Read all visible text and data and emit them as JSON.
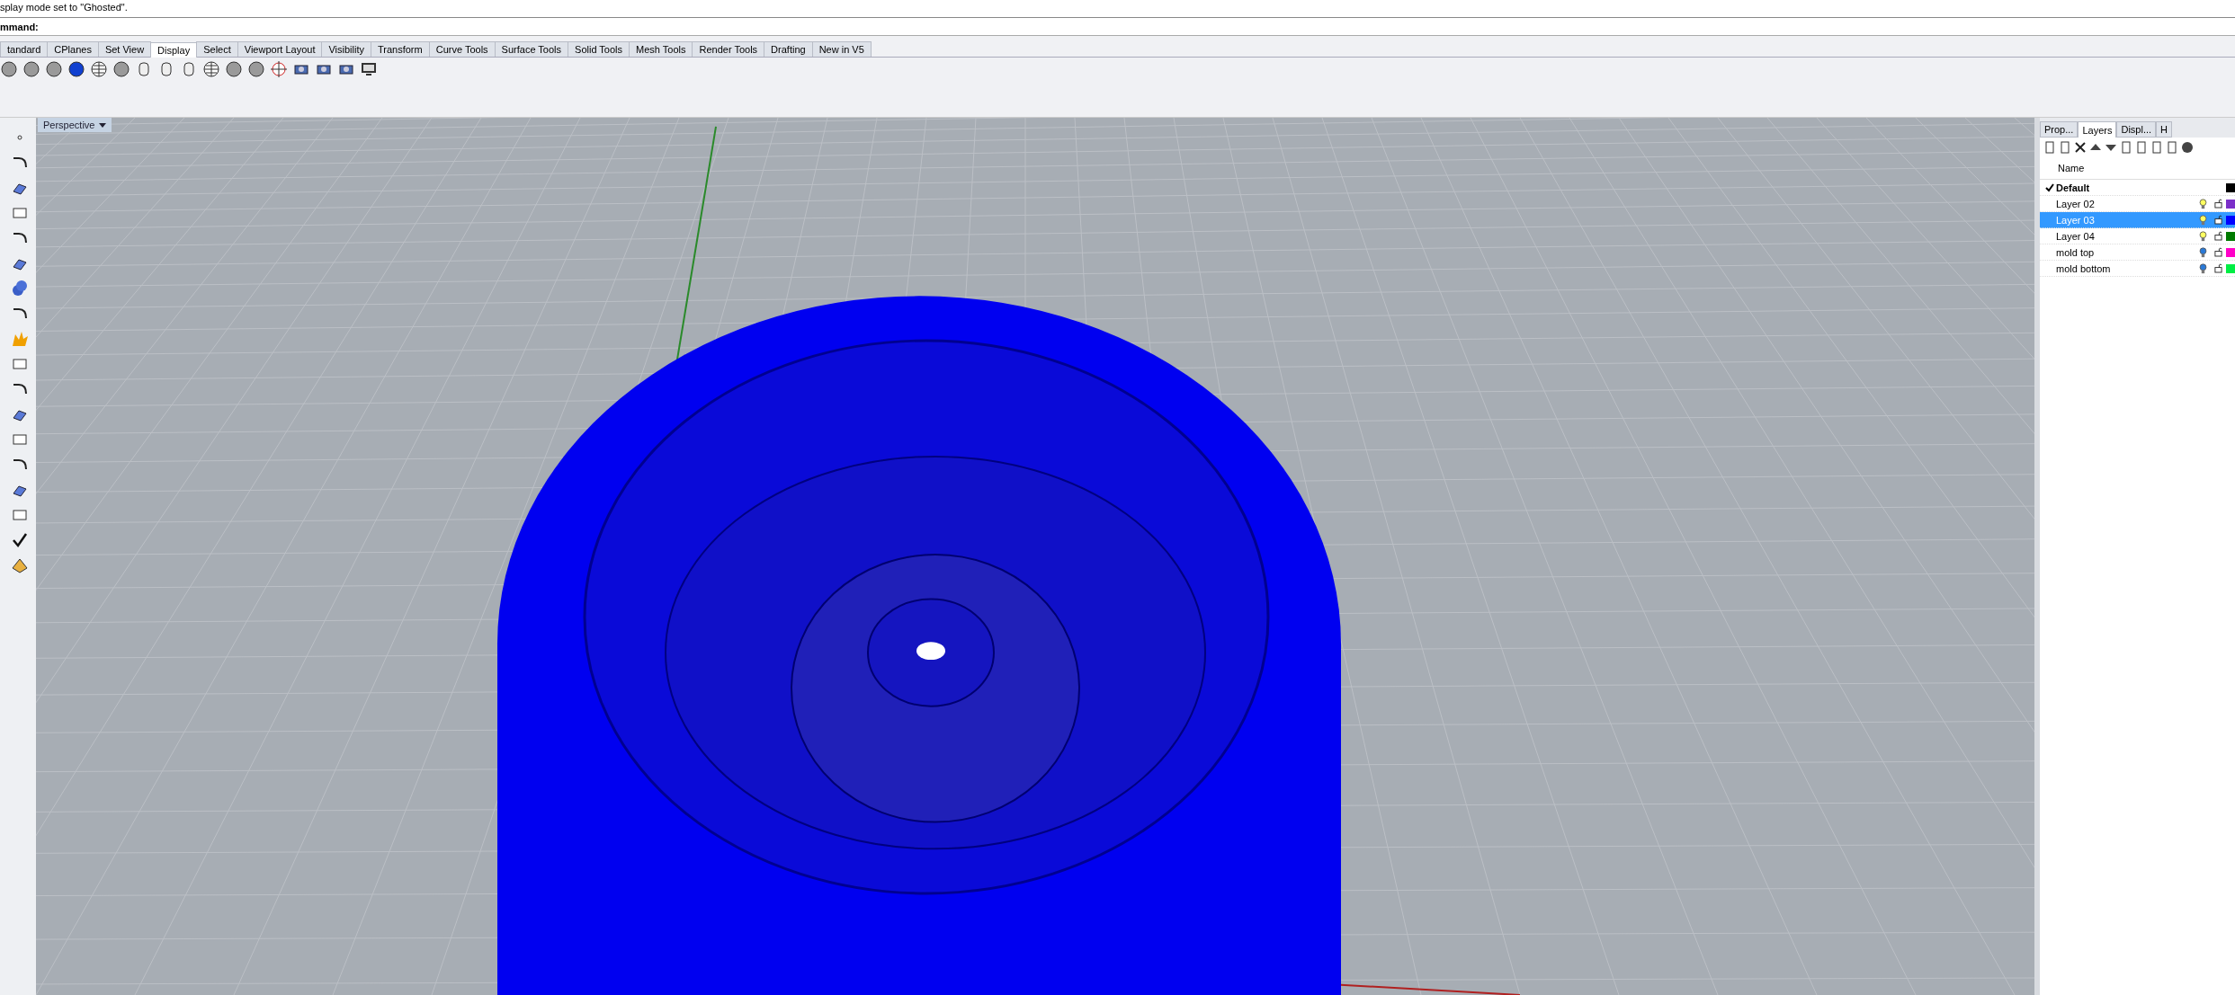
{
  "command_area": {
    "history": "splay mode set to \"Ghosted\".",
    "prompt": "mmand:"
  },
  "toolbar_tabs": [
    {
      "label": "tandard",
      "selected": false
    },
    {
      "label": "CPlanes",
      "selected": false
    },
    {
      "label": "Set View",
      "selected": false
    },
    {
      "label": "Display",
      "selected": true
    },
    {
      "label": "Select",
      "selected": false
    },
    {
      "label": "Viewport Layout",
      "selected": false
    },
    {
      "label": "Visibility",
      "selected": false
    },
    {
      "label": "Transform",
      "selected": false
    },
    {
      "label": "Curve Tools",
      "selected": false
    },
    {
      "label": "Surface Tools",
      "selected": false
    },
    {
      "label": "Solid Tools",
      "selected": false
    },
    {
      "label": "Mesh Tools",
      "selected": false
    },
    {
      "label": "Render Tools",
      "selected": false
    },
    {
      "label": "Drafting",
      "selected": false
    },
    {
      "label": "New in V5",
      "selected": false
    }
  ],
  "viewport": {
    "title": "Perspective"
  },
  "panel": {
    "tabs": [
      {
        "label": "Prop...",
        "selected": false
      },
      {
        "label": "Layers",
        "selected": true
      },
      {
        "label": "Displ...",
        "selected": false
      },
      {
        "label": "H",
        "selected": false
      }
    ],
    "column_header": "Name",
    "layers": [
      {
        "name": "Default",
        "current": true,
        "selected": false,
        "color": "#000000"
      },
      {
        "name": "Layer 02",
        "current": false,
        "selected": false,
        "light_on": true,
        "color": "#7b2fc9"
      },
      {
        "name": "Layer 03",
        "current": false,
        "selected": true,
        "light_on": true,
        "color": "#0000ff"
      },
      {
        "name": "Layer 04",
        "current": false,
        "selected": false,
        "light_on": true,
        "color": "#007a00"
      },
      {
        "name": "mold top",
        "current": false,
        "selected": false,
        "light_on": false,
        "color": "#ff00c8"
      },
      {
        "name": "mold bottom",
        "current": false,
        "selected": false,
        "light_on": false,
        "color": "#00ee44"
      }
    ]
  }
}
